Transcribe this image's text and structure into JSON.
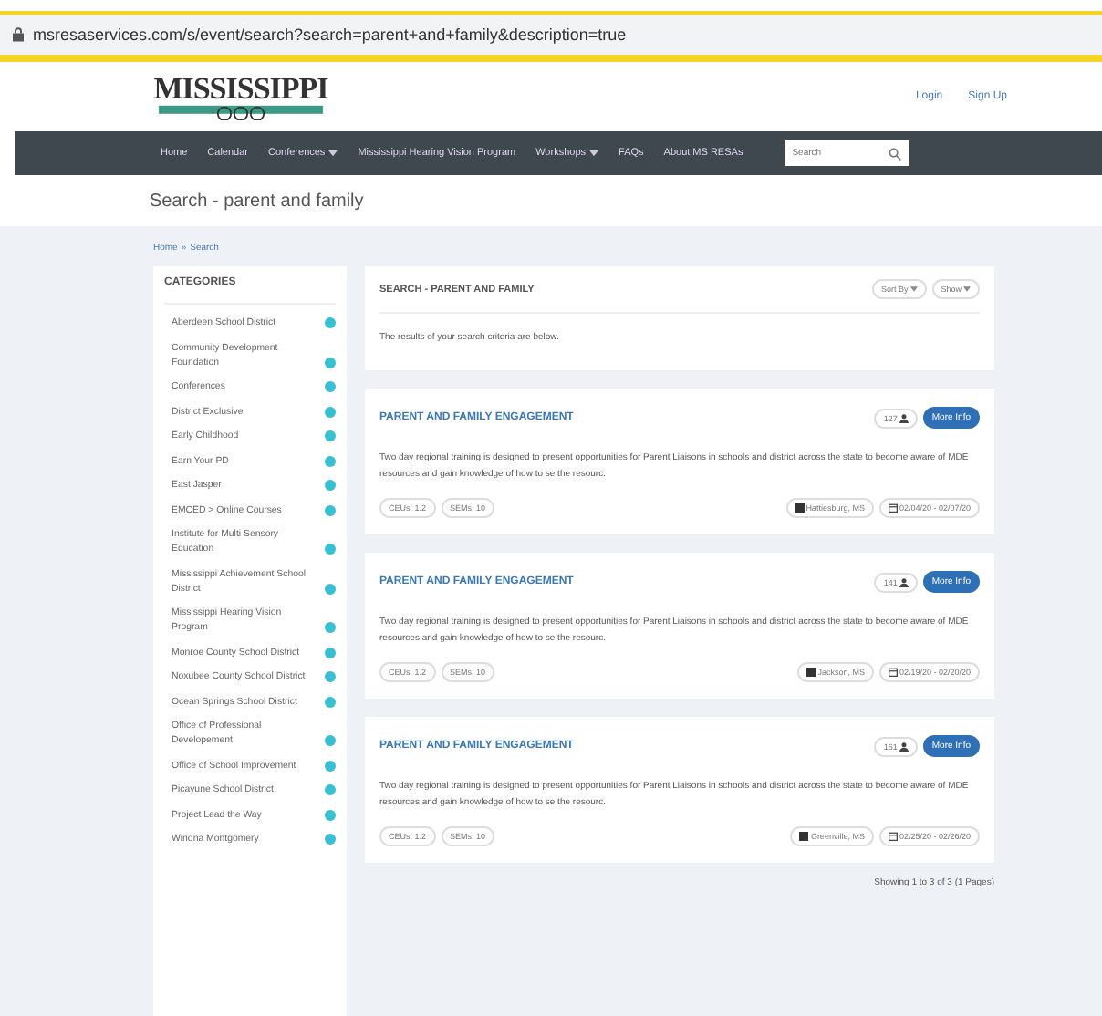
{
  "address_bar": {
    "url": "msresaservices.com/s/event/search?search=parent+and+family&description=true"
  },
  "header": {
    "logo": "MISSISSIPPI",
    "links": [
      "Login",
      "Sign Up"
    ]
  },
  "nav": {
    "items": [
      {
        "label": "Home",
        "dropdown": false
      },
      {
        "label": "Calendar",
        "dropdown": false
      },
      {
        "label": "Conferences",
        "dropdown": true
      },
      {
        "label": "Mississippi Hearing Vision Program",
        "dropdown": false
      },
      {
        "label": "Workshops",
        "dropdown": true
      },
      {
        "label": "FAQs",
        "dropdown": false
      },
      {
        "label": "About MS RESAs",
        "dropdown": false
      }
    ],
    "search": {
      "placeholder": "Search"
    }
  },
  "page_title": "Search - parent and family",
  "breadcrumb": {
    "separator": "»",
    "items": [
      "Home",
      "Search"
    ]
  },
  "sidebar": {
    "title": "CATEGORIES",
    "items": [
      {
        "label": "Aberdeen School District"
      },
      {
        "label": "Community Development Foundation"
      },
      {
        "label": "Conferences"
      },
      {
        "label": "District Exclusive"
      },
      {
        "label": "Early Childhood"
      },
      {
        "label": "Earn Your PD"
      },
      {
        "label": "East Jasper"
      },
      {
        "label": "EMCED > Online Courses"
      },
      {
        "label": "Institute for Multi Sensory Education"
      },
      {
        "label": "Mississippi Achievement School District"
      },
      {
        "label": "Mississippi Hearing Vision Program"
      },
      {
        "label": "Monroe County School District"
      },
      {
        "label": "Noxubee County School District"
      },
      {
        "label": "Ocean Springs School District"
      },
      {
        "label": "Office of Professional Developement"
      },
      {
        "label": "Office of School Improvement"
      },
      {
        "label": "Picayune School District"
      },
      {
        "label": "Project Lead the Way"
      },
      {
        "label": "Winona Montgomery"
      }
    ]
  },
  "results_header": {
    "title": "SEARCH - PARENT AND FAMILY",
    "buttons": [
      "Sort By",
      "Show"
    ],
    "message": "The results of your search criteria are below."
  },
  "events": [
    {
      "title": "PARENT AND FAMILY ENGAGEMENT",
      "attendees": "127",
      "button": "More Info",
      "description": "Two day regional training is designed to present opportunities for Parent Liaisons in schools and district across the state to become aware of MDE resources and gain knowledge of how to se the resourc.",
      "tags": [
        "CEUs: 1.2",
        "SEMs: 10"
      ],
      "location": "Hattiesburg, MS",
      "dates": "02/04/20 - 02/07/20"
    },
    {
      "title": "PARENT AND FAMILY ENGAGEMENT",
      "attendees": "141",
      "button": "More Info",
      "description": "Two day regional training is designed to present opportunities for Parent Liaisons in schools and district across the state to become aware of MDE resources and gain knowledge of how to se the resourc.",
      "tags": [
        "CEUs: 1.2",
        "SEMs: 10"
      ],
      "location": "Jackson, MS",
      "dates": "02/19/20 - 02/20/20"
    },
    {
      "title": "PARENT AND FAMILY ENGAGEMENT",
      "attendees": "161",
      "button": "More Info",
      "description": "Two day regional training is designed to present opportunities for Parent Liaisons in schools and district across the state to become aware of MDE resources and gain knowledge of how to se the resourc.",
      "tags": [
        "CEUs: 1.2",
        "SEMs: 10"
      ],
      "location": "Greenville, MS",
      "dates": "02/25/20 - 02/26/20"
    }
  ],
  "pagination": "Showing 1 to 3 of 3 (1 Pages)"
}
